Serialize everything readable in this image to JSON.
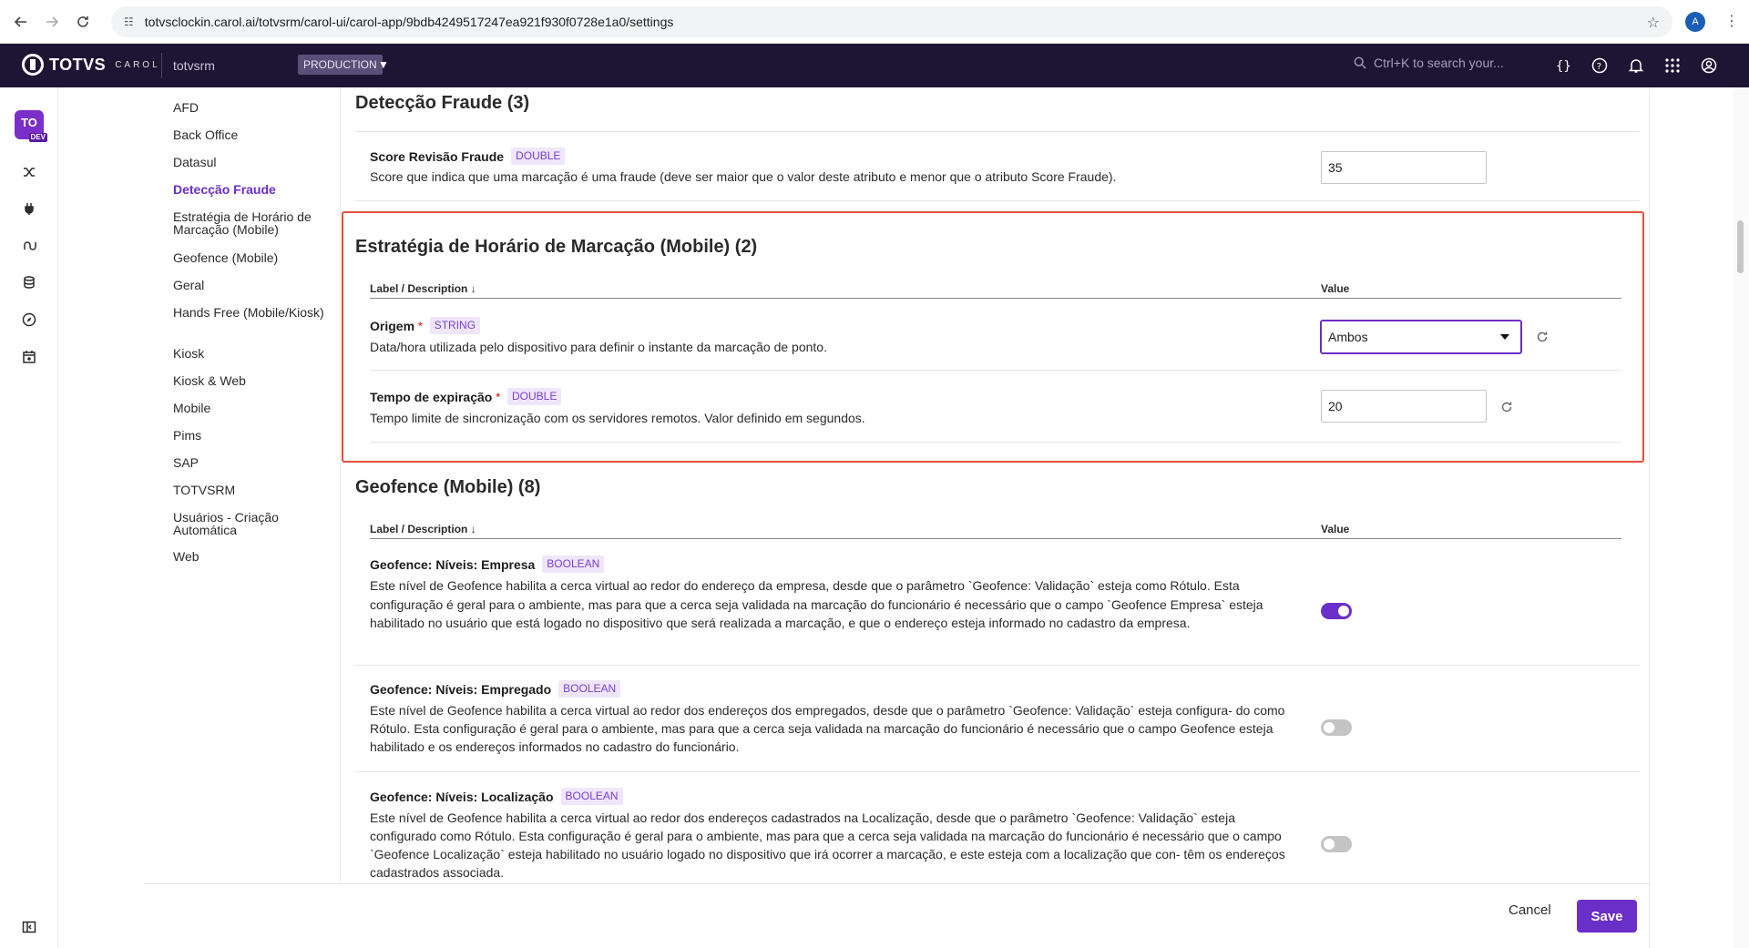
{
  "browser": {
    "url": "totvsclockin.carol.ai/totvsrm/carol-ui/carol-app/9bdb4249517247ea921f930f0728e1a0/settings",
    "profile_initial": "A"
  },
  "header": {
    "brand": "TOTVS",
    "brand_sub": "CAROL",
    "tenant": "totvsrm",
    "environment": "PRODUCTION",
    "search_placeholder": "Ctrl+K to search your..."
  },
  "rail": {
    "avatar": "TO",
    "avatar_badge": "DEV"
  },
  "sidebar": {
    "items": [
      {
        "label": "AFD"
      },
      {
        "label": "Back Office"
      },
      {
        "label": "Datasul"
      },
      {
        "label": "Detecção Fraude",
        "active": true
      },
      {
        "label": "Estratégia de Horário de Marcação (Mobile)"
      },
      {
        "label": "Geofence (Mobile)"
      },
      {
        "label": "Geral"
      },
      {
        "label": "Hands Free (Mobile/Kiosk)"
      },
      {
        "label": "Kiosk"
      },
      {
        "label": "Kiosk & Web"
      },
      {
        "label": "Mobile"
      },
      {
        "label": "Pims"
      },
      {
        "label": "SAP"
      },
      {
        "label": "TOTVSRM"
      },
      {
        "label": "Usuários - Criação Automática"
      },
      {
        "label": "Web"
      }
    ]
  },
  "sections": {
    "fraude": {
      "title": "Detecção Fraude (3)",
      "fields": [
        {
          "label": "Score Revisão Fraude",
          "type": "DOUBLE",
          "description": "Score que indica que uma marcação é uma fraude (deve ser maior que o valor deste atributo e menor que o atributo Score Fraude).",
          "value": "35"
        }
      ]
    },
    "estrategia": {
      "title": "Estratégia de Horário de Marcação (Mobile) (2)",
      "col_label": "Label / Description",
      "col_value": "Value",
      "fields": [
        {
          "label": "Origem",
          "type": "STRING",
          "description": "Data/hora utilizada pelo dispositivo para definir o instante da marcação de ponto.",
          "value": "Ambos"
        },
        {
          "label": "Tempo de expiração",
          "type": "DOUBLE",
          "description": "Tempo limite de sincronização com os servidores remotos. Valor definido em segundos.",
          "value": "20"
        }
      ]
    },
    "geofence": {
      "title": "Geofence (Mobile) (8)",
      "col_label": "Label / Description",
      "col_value": "Value",
      "fields": [
        {
          "label": "Geofence: Níveis: Empresa",
          "type": "BOOLEAN",
          "value": true,
          "description": "Este nível de Geofence habilita a cerca virtual ao redor do endereço da empresa, desde que o parâmetro `Geofence: Validação` esteja como Rótulo. Esta configuração é geral para o ambiente, mas para que a cerca seja validada na marcação do funcionário é necessário que o campo `Geofence Empresa` esteja habilitado no usuário que está logado no dispositivo que será realizada a marcação, e que o endereço esteja informado no cadastro da empresa."
        },
        {
          "label": "Geofence: Níveis: Empregado",
          "type": "BOOLEAN",
          "value": false,
          "description": "Este nível de Geofence habilita a cerca virtual ao redor dos endereços dos empregados, desde que o parâmetro `Geofence: Validação` esteja configura- do como Rótulo. Esta configuração é geral para o ambiente, mas para que a cerca seja validada na marcação do funcionário é necessário que o campo Geofence esteja habilitado e os endereços informados no cadastro do funcionário."
        },
        {
          "label": "Geofence: Níveis: Localização",
          "type": "BOOLEAN",
          "value": false,
          "description": "Este nível de Geofence habilita a cerca virtual ao redor dos endereços cadastrados na Localização, desde que o parâmetro `Geofence: Validação` esteja configurado como Rótulo. Esta configuração é geral para o ambiente, mas para que a cerca seja validada na marcação do funcionário é necessário que o campo `Geofence Localização` esteja habilitado no usuário logado no dispositivo que irá ocorrer a marcação, e este esteja com a localização que con- têm os endereços cadastrados associada."
        }
      ]
    }
  },
  "footer": {
    "cancel_label": "Cancel",
    "save_label": "Save"
  },
  "colors": {
    "accent": "#6a2ec9",
    "header_bg": "#1d1533",
    "highlight": "#e2503a"
  }
}
